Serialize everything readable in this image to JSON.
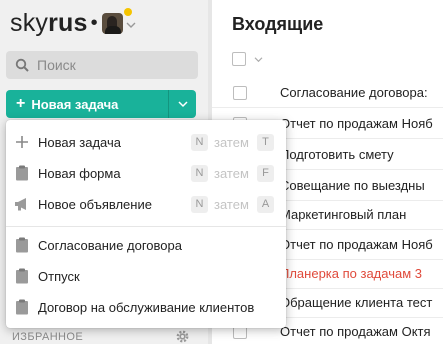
{
  "sidebar": {
    "logo": {
      "text_regular": "sky",
      "text_bold": "rus",
      "dot": "•"
    },
    "search": {
      "placeholder": "Поиск"
    },
    "new_task_button": {
      "plus": "+",
      "label": "Новая задача"
    },
    "favorites_label": "ИЗБРАННОЕ"
  },
  "main": {
    "title": "Входящие",
    "tasks": [
      {
        "title": "Согласование договора:"
      },
      {
        "title": "Отчет по продажам Нояб"
      },
      {
        "title": "Подготовить смету"
      },
      {
        "title": "Совещание по выездны"
      },
      {
        "title": "Маркетинговый план"
      },
      {
        "title": "Отчет по продажам Нояб"
      },
      {
        "title": "Планерка по задачам 3"
      },
      {
        "title": "Обращение клиента тест"
      },
      {
        "title": "Отчет по продажам Октя"
      }
    ]
  },
  "dropdown": {
    "create_items": [
      {
        "label": "Новая задача",
        "icon": "plus-icon",
        "key1": "N",
        "then": "затем",
        "key2": "T"
      },
      {
        "label": "Новая форма",
        "icon": "clipboard-icon",
        "key1": "N",
        "then": "затем",
        "key2": "F"
      },
      {
        "label": "Новое объявление",
        "icon": "megaphone-icon",
        "key1": "N",
        "then": "затем",
        "key2": "A"
      }
    ],
    "templates": [
      {
        "label": "Согласование договора",
        "icon": "clipboard-icon"
      },
      {
        "label": "Отпуск",
        "icon": "clipboard-icon"
      },
      {
        "label": "Договор на обслуживание клиентов",
        "icon": "clipboard-icon"
      }
    ]
  },
  "colors": {
    "accent": "#19b29a",
    "overdue_text": "#e04a3b",
    "sidebar_bg": "#f0f0f0",
    "badge": "#f5c400"
  }
}
